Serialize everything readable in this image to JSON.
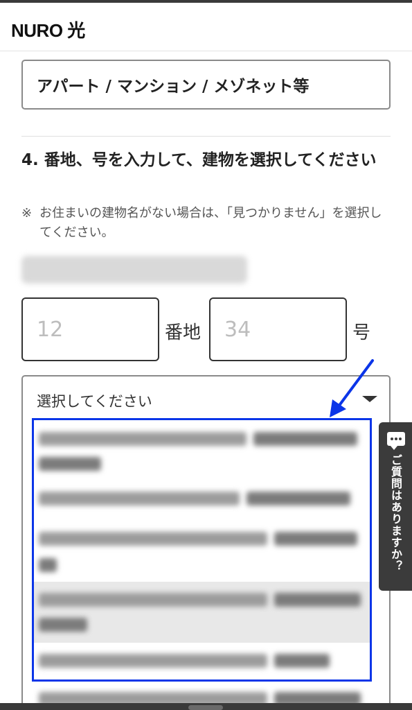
{
  "header": {
    "logo": "NURO 光"
  },
  "building_type": {
    "value": "アパート / マンション / メゾネット等"
  },
  "step4": {
    "heading": "4. 番地、号を入力して、建物を選択してください",
    "note_mark": "※",
    "note": "お住まいの建物名がない場合は、「見つかりません」を選択してください。"
  },
  "address_inputs": {
    "banchi_placeholder": "12",
    "banchi_unit": "番地",
    "go_placeholder": "34",
    "go_unit": "号"
  },
  "building_select": {
    "value": "選択してください"
  },
  "chat_tab": {
    "label": "ご質問はありますか？"
  },
  "colors": {
    "highlight": "#0b35e8",
    "arrow": "#0b35e8",
    "chat_tab_bg": "#3b3b3b"
  },
  "icons": [
    "chevron-down-icon",
    "speech-bubble-icon",
    "annotation-arrow"
  ]
}
